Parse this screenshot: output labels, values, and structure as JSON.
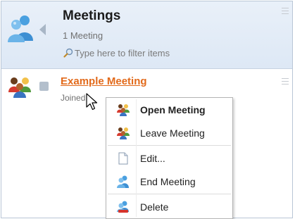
{
  "header": {
    "title": "Meetings",
    "subtitle": "1 Meeting",
    "filter_placeholder": "Type here to filter items"
  },
  "list": {
    "items": [
      {
        "title": "Example Meeting",
        "status_text": "Joined"
      }
    ]
  },
  "context_menu": {
    "items": [
      {
        "label": "Open Meeting",
        "icon": "meeting-group-icon"
      },
      {
        "label": "Leave Meeting",
        "icon": "meeting-group-icon"
      },
      {
        "label": "Edit...",
        "icon": "document-icon"
      },
      {
        "label": "End Meeting",
        "icon": "end-meeting-icon"
      },
      {
        "label": "Delete",
        "icon": "delete-icon"
      }
    ]
  },
  "colors": {
    "accent_link": "#e26a1b",
    "header_bg": "#dde8f5",
    "border": "#b9c6d6"
  }
}
